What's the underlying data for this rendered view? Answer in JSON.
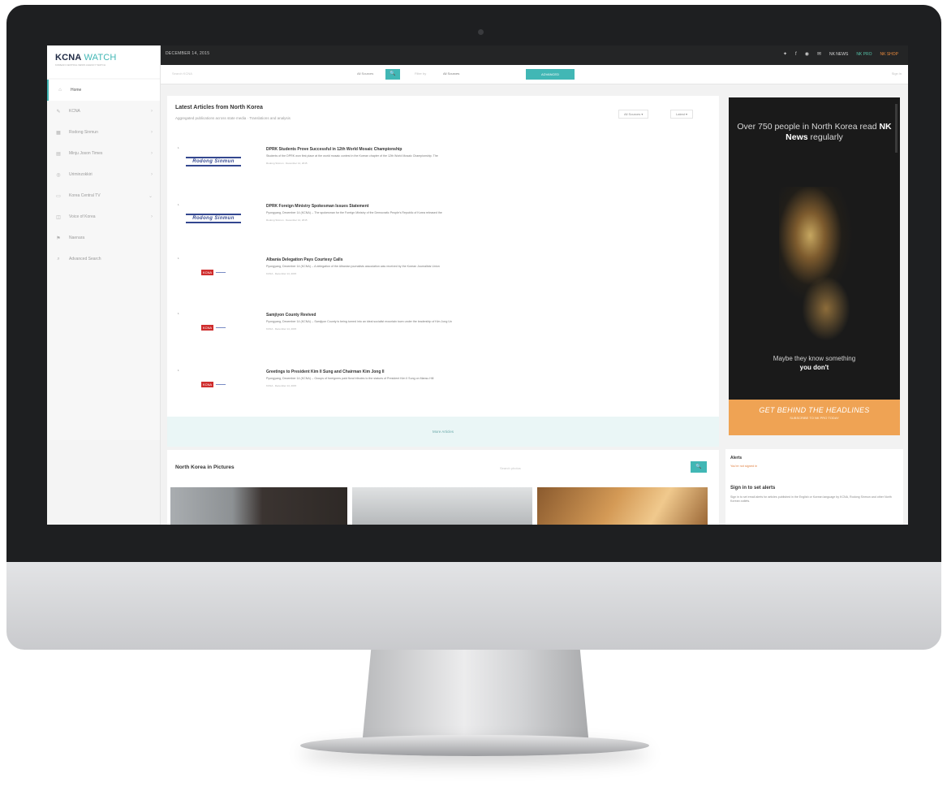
{
  "topbar": {
    "date": "DECEMBER 14, 2015",
    "icons": [
      "twitter-icon",
      "facebook-icon",
      "rss-icon",
      "email-icon"
    ],
    "links": [
      "NK NEWS",
      "NK PRO",
      "NK SHOP"
    ]
  },
  "logo": {
    "name_dark": "KCNA",
    "name_accent": "WATCH",
    "tagline": "KOREAN CENTRAL NEWS AGENCY WATCH"
  },
  "sidebar": {
    "items": [
      {
        "label": "Home",
        "icon": "home-icon",
        "chevron": false
      },
      {
        "label": "KCNA",
        "icon": "pen-icon",
        "chevron": true
      },
      {
        "label": "Rodong Sinmun",
        "icon": "newspaper-icon",
        "chevron": true
      },
      {
        "label": "Minju Joson Times",
        "icon": "document-icon",
        "chevron": true
      },
      {
        "label": "Uriminzokkiri",
        "icon": "globe-icon",
        "chevron": true
      },
      {
        "label": "Korea Central TV",
        "icon": "tv-icon",
        "chevron": true
      },
      {
        "label": "Voice of Korea",
        "icon": "radio-icon",
        "chevron": true
      },
      {
        "label": "Naenara",
        "icon": "flag-icon",
        "chevron": false
      },
      {
        "label": "Advanced Search",
        "icon": "search-icon",
        "chevron": false
      }
    ]
  },
  "searchbar": {
    "placeholder": "Search KCNA",
    "select_all": "All Sources",
    "search_glyph": "🔍",
    "filter_label": "Filter by",
    "select_source": "All Sources",
    "advanced": "ADVANCED",
    "right_link": "Sign in"
  },
  "articles": {
    "title": "Latest Articles from North Korea",
    "subtitle": "Aggregated publications across state media · Translations and analysis",
    "filter_sources": "All Sources ▾",
    "filter_sort": "Latest ▾",
    "more_label": "More Articles",
    "items": [
      {
        "thumb": "rodong",
        "thumb_text": "Rodong Sinmun",
        "date_tag": "1",
        "headline": "DPRK Students Prove Successful in 12th World Mosaic Championship",
        "snippet": "Students of the DPRK won first place at the world mosaic contest in the Korean chapter of the 12th World Mosaic Championship. The",
        "meta": "Rodong Sinmun · December 14, 2015"
      },
      {
        "thumb": "rodong",
        "thumb_text": "Rodong Sinmun",
        "date_tag": "1",
        "headline": "DPRK Foreign Ministry Spokesman Issues Statement",
        "snippet": "Pyongyang, December 14 (KCNA) -- The spokesman for the Foreign Ministry of the Democratic People's Republic of Korea released the",
        "meta": "Rodong Sinmun · December 14, 2015"
      },
      {
        "thumb": "kcna",
        "thumb_text": "KCNA",
        "date_tag": "1",
        "headline": "Albania Delegation Pays Courtesy Calls",
        "snippet": "Pyongyang, December 14 (KCNA) -- A delegation of the Albanian journalists association was received by the Korean Journalists Union",
        "meta": "KCNA · December 14, 2015"
      },
      {
        "thumb": "kcna",
        "thumb_text": "KCNA",
        "date_tag": "1",
        "headline": "Samjiyon County Revived",
        "snippet": "Pyongyang, December 14 (KCNA) -- Samjiyon County is being turned into an ideal socialist mountain town under the leadership of Kim Jong Un",
        "meta": "KCNA · December 14, 2015"
      },
      {
        "thumb": "kcna",
        "thumb_text": "KCNA",
        "date_tag": "1",
        "headline": "Greetings to President Kim Il Sung and Chairman Kim Jong Il",
        "snippet": "Pyongyang, December 14 (KCNA) -- Groups of foreigners paid floral tributes to the statues of President Kim Il Sung on Mansu Hill",
        "meta": "KCNA · December 14, 2015"
      }
    ]
  },
  "pictures": {
    "title": "North Korea in Pictures",
    "search_placeholder": "Search photos",
    "search_glyph": "🔍"
  },
  "ad": {
    "headline_pre": "Over 750 people in North Korea read",
    "headline_brand": "NK News",
    "headline_post": "regularly",
    "tagline_pre": "Maybe they know something",
    "tagline_bold": "you don't",
    "cta": "GET BEHIND THE HEADLINES",
    "cta_sub": "SUBSCRIBE TO NK PRO TODAY"
  },
  "alerts": {
    "title": "Alerts",
    "subtitle": "You're not signed in",
    "signin_title": "Sign in to set alerts",
    "signin_desc": "Sign in to set email alerts for articles published in the English or Korean language by KCNA, Rodong Sinmun and other North Korean outlets."
  },
  "colors": {
    "accent": "#41b7b5",
    "topbar": "#242526",
    "cta": "#efa354",
    "alert_text": "#e07f3f"
  }
}
